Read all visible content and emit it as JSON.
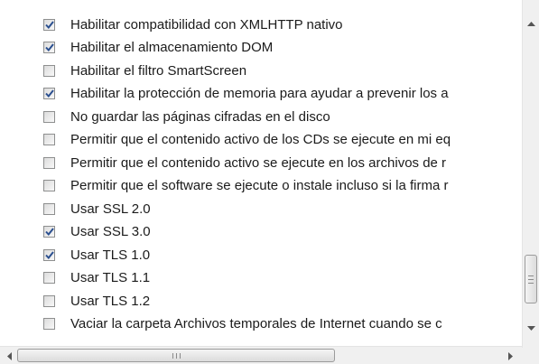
{
  "settings_list": {
    "items": [
      {
        "label": "Habilitar compatibilidad con XMLHTTP nativo",
        "checked": true
      },
      {
        "label": "Habilitar el almacenamiento DOM",
        "checked": true
      },
      {
        "label": "Habilitar el filtro SmartScreen",
        "checked": false
      },
      {
        "label": "Habilitar la protección de memoria para ayudar a prevenir los a",
        "checked": true
      },
      {
        "label": "No guardar las páginas cifradas en el disco",
        "checked": false
      },
      {
        "label": "Permitir que el contenido activo de los CDs se ejecute en mi eq",
        "checked": false
      },
      {
        "label": "Permitir que el contenido activo se ejecute en los archivos de r",
        "checked": false
      },
      {
        "label": "Permitir que el software se ejecute o instale incluso si la firma r",
        "checked": false
      },
      {
        "label": "Usar SSL 2.0",
        "checked": false
      },
      {
        "label": "Usar SSL 3.0",
        "checked": true
      },
      {
        "label": "Usar TLS 1.0",
        "checked": true
      },
      {
        "label": "Usar TLS 1.1",
        "checked": false
      },
      {
        "label": "Usar TLS 1.2",
        "checked": false
      },
      {
        "label": "Vaciar la carpeta Archivos temporales de Internet cuando se c",
        "checked": false
      }
    ]
  },
  "colors": {
    "check_mark": "#2a4f8f",
    "checkbox_border": "#8e8f8f",
    "text": "#1b1b1b",
    "scrollbar_bg": "#f0f0f0"
  },
  "icons": {
    "scroll_up": "triangle-up-icon",
    "scroll_down": "triangle-down-icon",
    "scroll_left": "triangle-left-icon",
    "scroll_right": "triangle-right-icon"
  }
}
